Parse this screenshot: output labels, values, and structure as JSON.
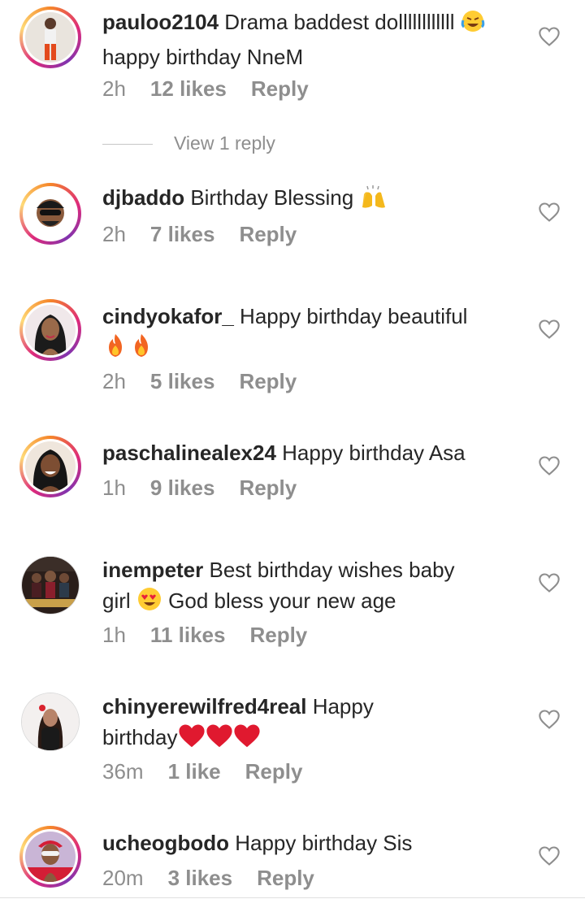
{
  "comments": [
    {
      "username": "pauloo2104",
      "text": " Drama baddest dollllllllllll ",
      "text2": "happy birthday NneM",
      "time": "2h",
      "likes": "12 likes",
      "reply": "Reply"
    },
    {
      "username": "djbaddo",
      "text": " Birthday Blessing ",
      "time": "2h",
      "likes": "7 likes",
      "reply": "Reply"
    },
    {
      "username": "cindyokafor_",
      "text": " Happy birthday beautiful",
      "time": "2h",
      "likes": "5 likes",
      "reply": "Reply"
    },
    {
      "username": "paschalinealex24",
      "text": " Happy birthday Asa",
      "time": "1h",
      "likes": "9 likes",
      "reply": "Reply"
    },
    {
      "username": "inempeter",
      "text": " Best  birthday wishes baby",
      "text2": "girl ",
      "text3": " God bless your new age",
      "time": "1h",
      "likes": "11 likes",
      "reply": "Reply"
    },
    {
      "username": "chinyerewilfred4real",
      "text": " Happy",
      "text2": "birthday",
      "time": "36m",
      "likes": "1 like",
      "reply": "Reply"
    },
    {
      "username": "ucheogbodo",
      "text": " Happy birthday Sis",
      "time": "20m",
      "likes": "3 likes",
      "reply": "Reply"
    }
  ],
  "view_replies": "View 1 reply",
  "icons": {
    "like": "heart-outline-icon"
  },
  "colors": {
    "secondary_text": "#8e8e8e",
    "primary_text": "#262626",
    "story_ring_start": "#f58529",
    "story_ring_mid": "#dd2a7b"
  }
}
